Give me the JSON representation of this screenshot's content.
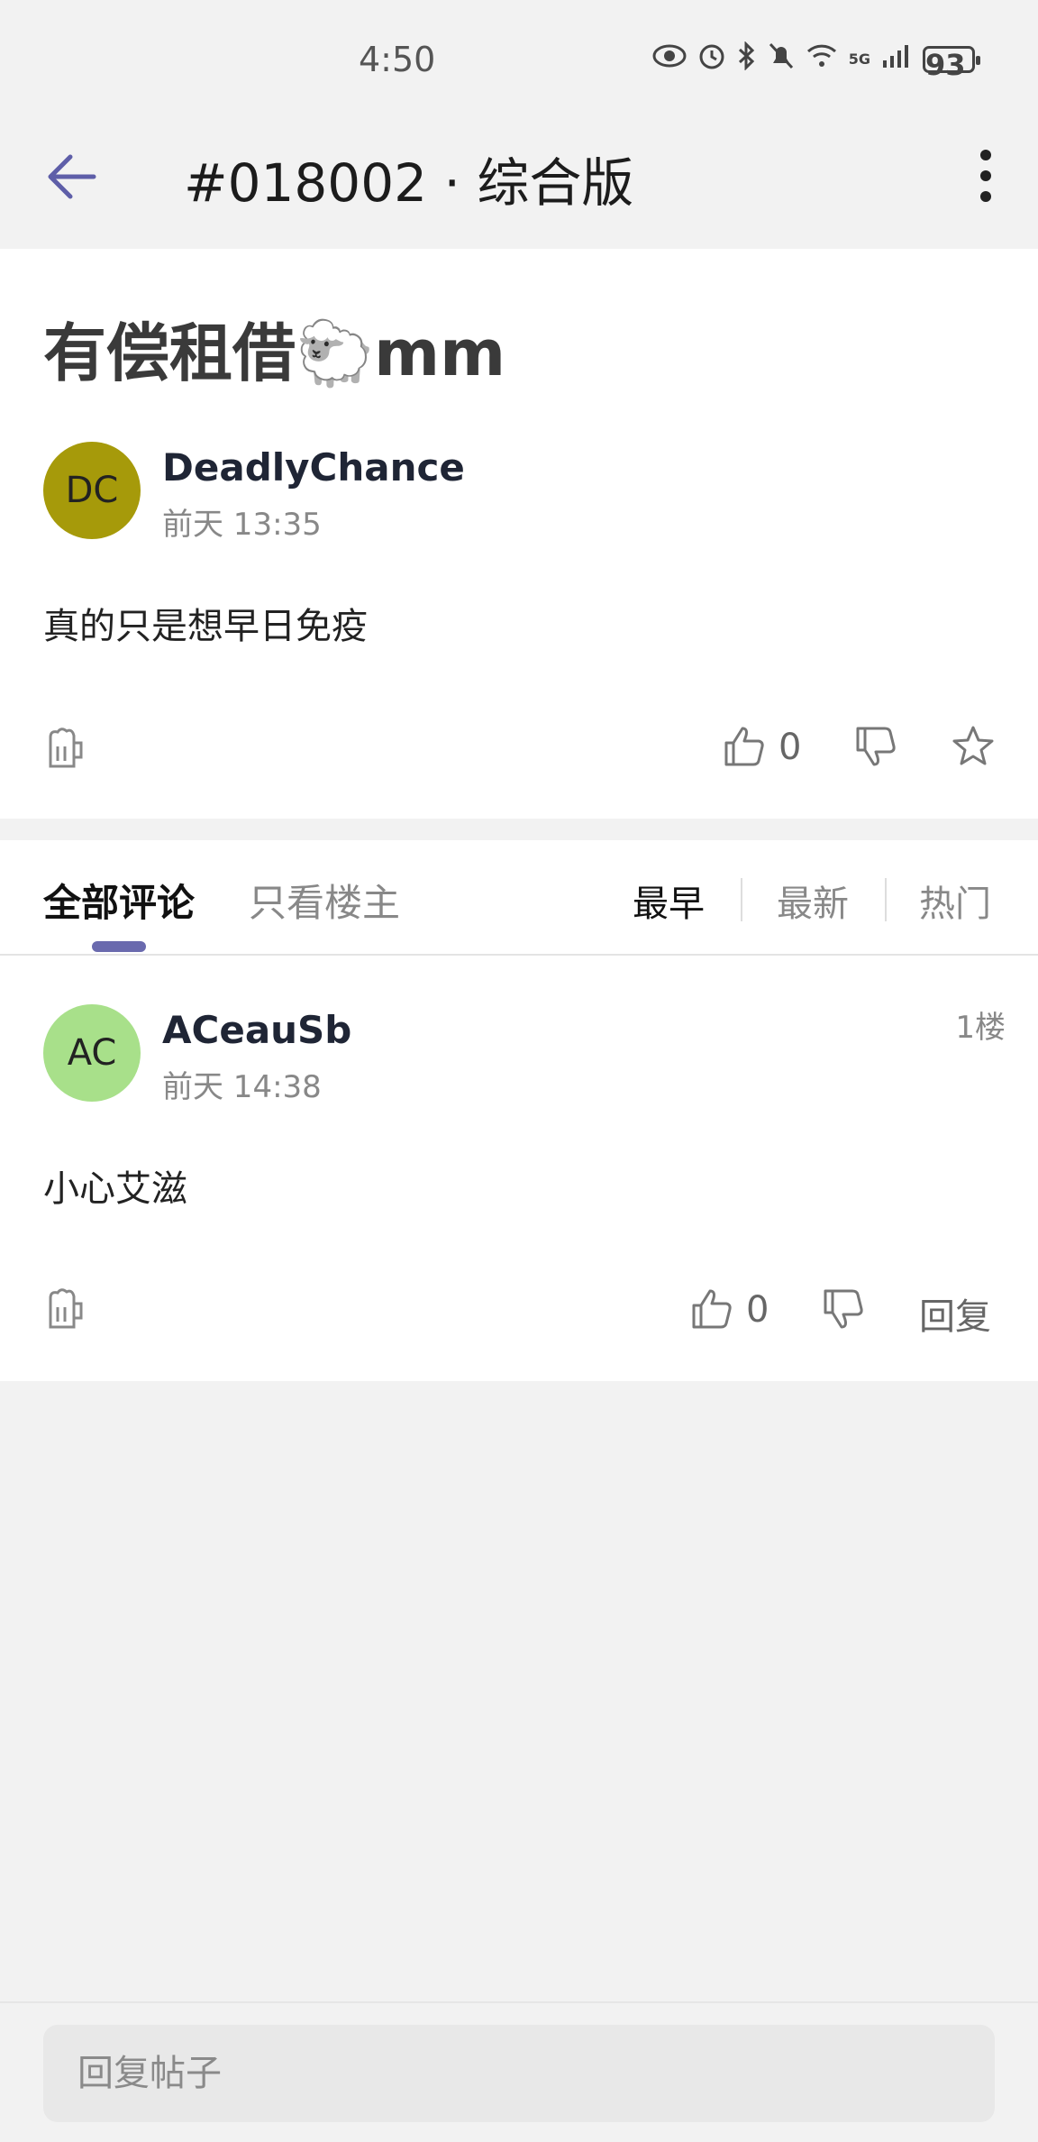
{
  "status_bar": {
    "time": "4:50",
    "battery": "93",
    "network": "5G"
  },
  "app_bar": {
    "title": "#018002 · 综合版"
  },
  "post": {
    "title": "有偿租借🐑mm",
    "author": {
      "initials": "DC",
      "name": "DeadlyChance",
      "time": "前天 13:35",
      "avatar_color": "#a69a0a"
    },
    "body": "真的只是想早日免疫",
    "likes": "0"
  },
  "comment_tabs": {
    "all": "全部评论",
    "op_only": "只看楼主"
  },
  "sort_options": [
    "最早",
    "最新",
    "热门"
  ],
  "comments": [
    {
      "author": {
        "initials": "AC",
        "name": "ACeauSb",
        "time": "前天 14:38",
        "avatar_color": "#a8e08a"
      },
      "floor": "1楼",
      "body": "小心艾滋",
      "likes": "0",
      "reply_label": "回复"
    }
  ],
  "reply_bar": {
    "placeholder": "回复帖子"
  },
  "colors": {
    "accent": "#6a6aae",
    "background": "#f2f2f2"
  }
}
